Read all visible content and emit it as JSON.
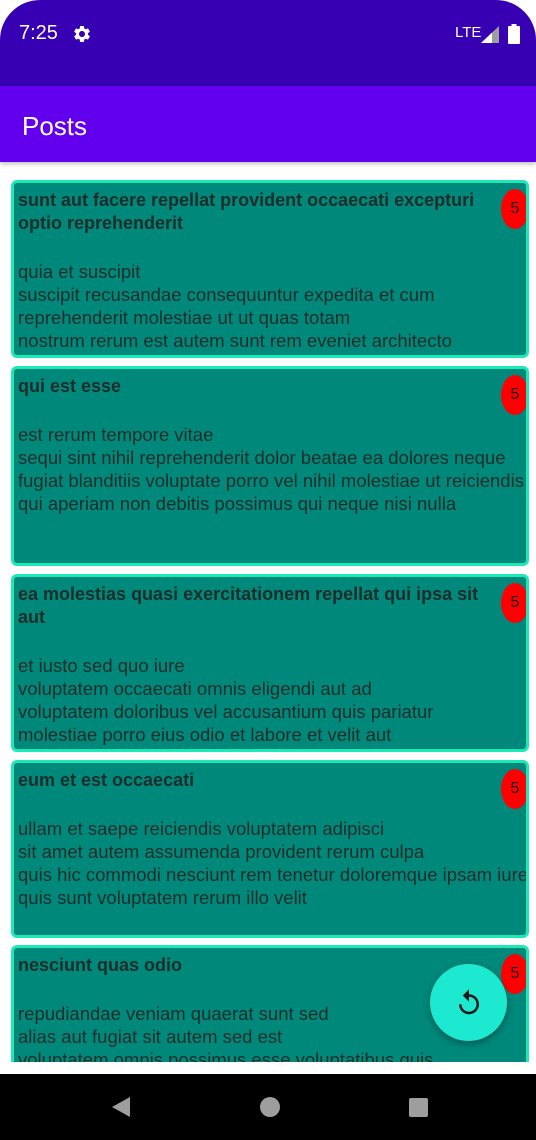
{
  "status_bar": {
    "time": "7:25",
    "network": "LTE",
    "background": "#3700b3"
  },
  "app_bar": {
    "title": "Posts",
    "background": "#6200ee"
  },
  "posts": [
    {
      "title": "sunt aut facere repellat provident occaecati excepturi optio reprehenderit",
      "body": "quia et suscipit\nsuscipit recusandae consequuntur expedita et cum reprehenderit molestiae ut ut quas totam\nnostrum rerum est autem sunt rem eveniet architecto",
      "badge": "5"
    },
    {
      "title": "qui est esse",
      "body": "est rerum tempore vitae\nsequi sint nihil reprehenderit dolor beatae ea dolores neque\nfugiat blanditiis voluptate porro vel nihil molestiae ut reiciendis\nqui aperiam non debitis possimus qui neque nisi nulla",
      "badge": "5"
    },
    {
      "title": "ea molestias quasi exercitationem repellat qui ipsa sit aut",
      "body": "et iusto sed quo iure\nvoluptatem occaecati omnis eligendi aut ad\nvoluptatem doloribus vel accusantium quis pariatur\nmolestiae porro eius odio et labore et velit aut",
      "badge": "5"
    },
    {
      "title": "eum et est occaecati",
      "body": "ullam et saepe reiciendis voluptatem adipisci\nsit amet autem assumenda provident rerum culpa\nquis hic commodi nesciunt rem tenetur doloremque ipsam iure\nquis sunt voluptatem rerum illo velit",
      "badge": "5"
    },
    {
      "title": "nesciunt quas odio",
      "body": "repudiandae veniam quaerat sunt sed\nalias aut fugiat sit autem sed est\nvoluptatem omnis possimus esse voluptatibus quis",
      "badge": "5"
    }
  ],
  "fab": {
    "icon": "refresh-icon"
  },
  "colors": {
    "card_fill": "#00897b",
    "card_border": "#1de9b6",
    "badge": "#ff0000",
    "fab": "#1de9d0"
  }
}
